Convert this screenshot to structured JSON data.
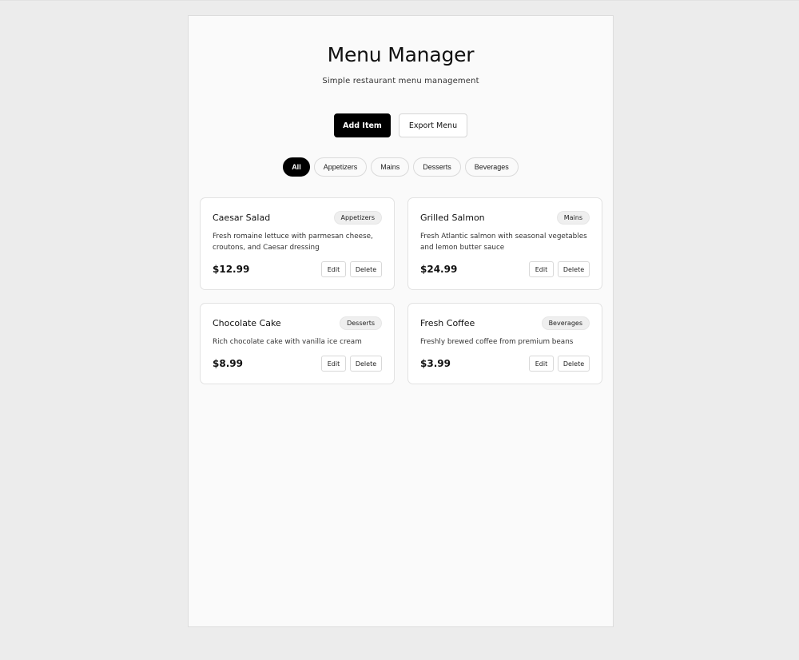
{
  "header": {
    "title": "Menu Manager",
    "subtitle": "Simple restaurant menu management"
  },
  "actions": {
    "add_label": "Add Item",
    "export_label": "Export Menu"
  },
  "filters": [
    "All",
    "Appetizers",
    "Mains",
    "Desserts",
    "Beverages"
  ],
  "active_filter": "All",
  "items": [
    {
      "name": "Caesar Salad",
      "category": "Appetizers",
      "description": "Fresh romaine lettuce with parmesan cheese, croutons, and Caesar dressing",
      "price": "$12.99",
      "edit_label": "Edit",
      "delete_label": "Delete"
    },
    {
      "name": "Grilled Salmon",
      "category": "Mains",
      "description": "Fresh Atlantic salmon with seasonal vegetables and lemon butter sauce",
      "price": "$24.99",
      "edit_label": "Edit",
      "delete_label": "Delete"
    },
    {
      "name": "Chocolate Cake",
      "category": "Desserts",
      "description": "Rich chocolate cake with vanilla ice cream",
      "price": "$8.99",
      "edit_label": "Edit",
      "delete_label": "Delete"
    },
    {
      "name": "Fresh Coffee",
      "category": "Beverages",
      "description": "Freshly brewed coffee from premium beans",
      "price": "$3.99",
      "edit_label": "Edit",
      "delete_label": "Delete"
    }
  ],
  "colors": {
    "primary": "#000000",
    "background": "#ececec",
    "panel": "#fafafa",
    "card": "#ffffff",
    "badge": "#efefef"
  }
}
